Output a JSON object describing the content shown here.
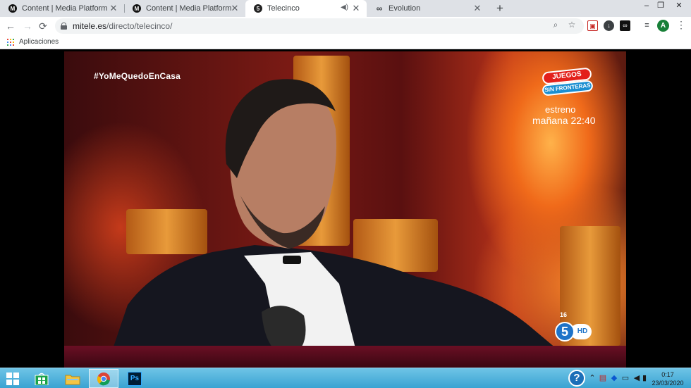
{
  "browser": {
    "tabs": [
      {
        "title": "Content | Media Platform",
        "icon": "M",
        "active": false
      },
      {
        "title": "Content | Media Platform",
        "icon": "M",
        "active": false
      },
      {
        "title": "Telecinco",
        "icon": "5",
        "active": true
      },
      {
        "title": "Evolution",
        "icon": "∞",
        "active": false
      }
    ],
    "new_tab": "+",
    "window_controls": {
      "minimize": "–",
      "maximize": "❐",
      "close": "✕"
    },
    "nav": {
      "back": "←",
      "forward": "→",
      "reload": "⟳"
    },
    "address": {
      "host": "mitele.es",
      "path": "/directo/telecinco/"
    },
    "profile_initial": "A",
    "bookmarks": [
      {
        "label": "Aplicaciones"
      }
    ],
    "colors": {
      "tabstrip": "#dee1e6",
      "accent": "#188038"
    }
  },
  "video": {
    "hashtag": "#YoMeQuedoEnCasa",
    "promo": {
      "logo_line1": "JUEGOS",
      "logo_line2": "SIN FRONTERAS",
      "line1": "estreno",
      "line2": "mañana 22:40"
    },
    "rating": "16",
    "channel": {
      "number": "5",
      "hd": "HD"
    }
  },
  "taskbar": {
    "apps": [
      {
        "name": "start",
        "icon": "windows-logo"
      },
      {
        "name": "store",
        "icon": "store-icon"
      },
      {
        "name": "explorer",
        "icon": "folder-icon"
      },
      {
        "name": "chrome",
        "icon": "chrome-icon",
        "active": true
      },
      {
        "name": "photoshop",
        "icon": "photoshop-icon",
        "label": "Ps"
      }
    ],
    "tray": {
      "help": "?",
      "time": "0:17",
      "date": "23/03/2020"
    }
  }
}
